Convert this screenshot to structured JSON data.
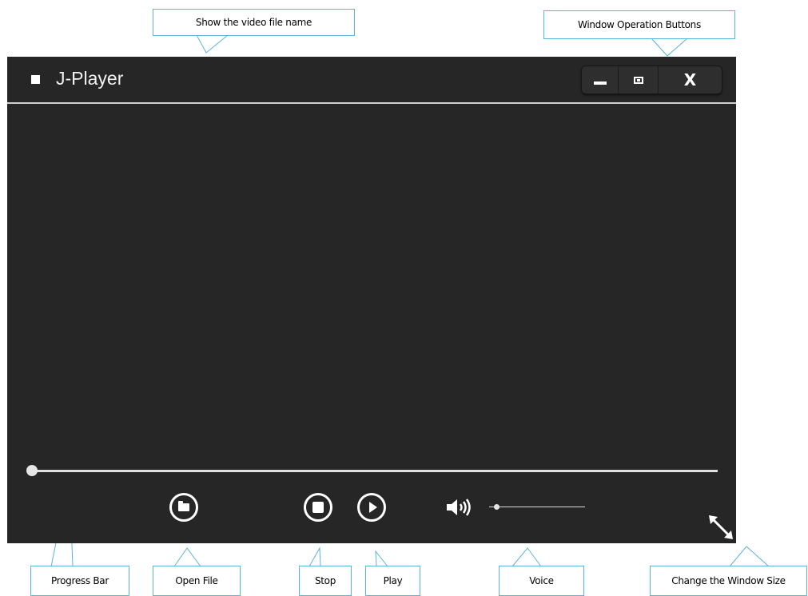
{
  "callouts": {
    "show_file_name": "Show the video file name",
    "window_buttons": "Window Operation Buttons",
    "progress_bar": "Progress Bar",
    "open_file": "Open File",
    "stop": "Stop",
    "play": "Play",
    "voice": "Voice",
    "change_size": "Change the Window Size"
  },
  "player": {
    "title": "J-Player",
    "window_buttons": {
      "minimize_icon": "minimize-icon",
      "maximize_icon": "maximize-icon",
      "close_icon": "close-icon",
      "close_glyph": "X"
    },
    "progress": {
      "value": 0
    },
    "volume": {
      "value": 0.05
    },
    "controls": [
      "folder-icon",
      "stop-icon",
      "play-icon",
      "speaker-icon",
      "resize-diagonal-icon"
    ]
  },
  "colors": {
    "window_bg": "#262626",
    "callout_border": "#5ab4d6",
    "foreground": "#ffffff"
  }
}
